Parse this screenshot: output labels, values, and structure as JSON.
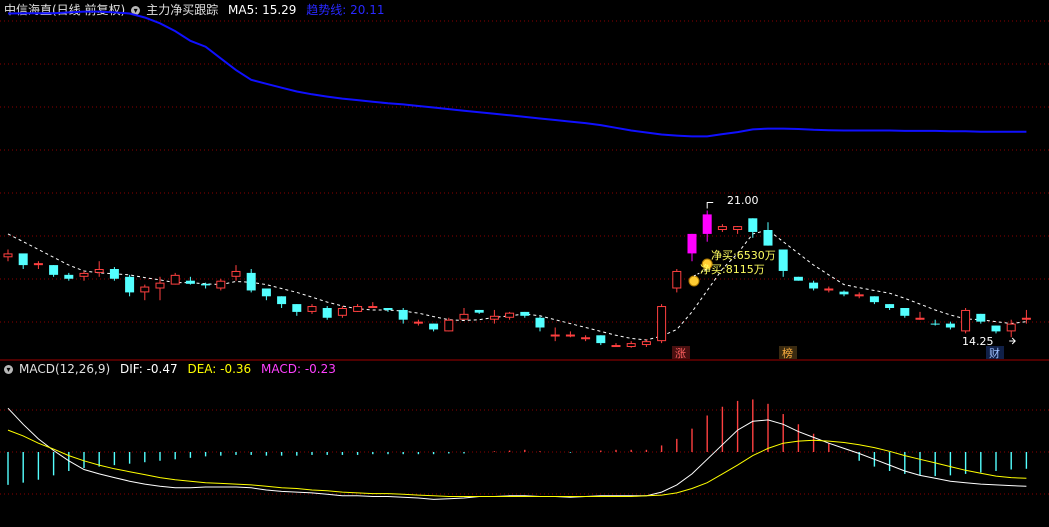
{
  "header": {
    "stock": "中信海直(日线 前复权)",
    "indicator": "主力净买跟踪",
    "ma5": "MA5: 15.29",
    "trend": "趋势线: 20.11"
  },
  "macd_header": {
    "name": "MACD(12,26,9)",
    "dif": "DIF: -0.47",
    "dea": "DEA: -0.36",
    "macd": "MACD: -0.23"
  },
  "annotations": {
    "high": "21.00",
    "low": "14.25",
    "netbuy1": "净买:6530万",
    "netbuy2": "净买:8115万",
    "tag_zhang": "涨",
    "tag_bang": "榜",
    "tag_cai": "财"
  },
  "colors": {
    "up": "#ff4040",
    "down": "#54ffff",
    "special": "#ff00ff",
    "trend_line": "#1010ff",
    "ma_dotted": "#ffffff",
    "dif": "#ffffff",
    "dea": "#ffff00",
    "grid": "#8b0000"
  },
  "chart_data": [
    {
      "type": "candlestick",
      "title": "中信海直(日线 前复权)",
      "candles": [
        [
          16.3,
          16.5,
          16.2,
          16.4
        ],
        [
          16.4,
          16.3,
          16.0,
          16.1
        ],
        [
          16.1,
          16.2,
          16.0,
          16.15
        ],
        [
          16.1,
          16.1,
          15.8,
          15.85
        ],
        [
          15.85,
          15.9,
          15.7,
          15.75
        ],
        [
          15.8,
          15.95,
          15.7,
          15.9
        ],
        [
          15.9,
          16.2,
          15.8,
          16.0
        ],
        [
          16.0,
          16.05,
          15.7,
          15.75
        ],
        [
          15.8,
          15.85,
          15.3,
          15.4
        ],
        [
          15.4,
          15.6,
          15.2,
          15.55
        ],
        [
          15.5,
          15.8,
          15.2,
          15.65
        ],
        [
          15.6,
          15.9,
          15.6,
          15.85
        ],
        [
          15.7,
          15.8,
          15.6,
          15.62
        ],
        [
          15.62,
          15.65,
          15.5,
          15.58
        ],
        [
          15.5,
          15.75,
          15.45,
          15.7
        ],
        [
          15.8,
          16.1,
          15.7,
          15.95
        ],
        [
          15.9,
          16.0,
          15.4,
          15.45
        ],
        [
          15.5,
          15.5,
          15.2,
          15.3
        ],
        [
          15.3,
          15.3,
          15.0,
          15.1
        ],
        [
          15.1,
          15.1,
          14.8,
          14.9
        ],
        [
          14.9,
          15.1,
          14.85,
          15.05
        ],
        [
          15.0,
          15.05,
          14.7,
          14.75
        ],
        [
          14.8,
          15.05,
          14.75,
          15.0
        ],
        [
          14.9,
          15.1,
          14.9,
          15.05
        ],
        [
          15.0,
          15.15,
          15.0,
          15.05
        ],
        [
          15.0,
          15.0,
          14.9,
          14.95
        ],
        [
          14.95,
          15.0,
          14.6,
          14.7
        ],
        [
          14.6,
          14.7,
          14.55,
          14.65
        ],
        [
          14.6,
          14.6,
          14.4,
          14.45
        ],
        [
          14.4,
          14.75,
          14.4,
          14.7
        ],
        [
          14.7,
          15.0,
          14.7,
          14.85
        ],
        [
          14.95,
          14.95,
          14.85,
          14.88
        ],
        [
          14.7,
          14.95,
          14.6,
          14.8
        ],
        [
          14.75,
          14.9,
          14.7,
          14.88
        ],
        [
          14.9,
          14.9,
          14.75,
          14.8
        ],
        [
          14.75,
          14.78,
          14.4,
          14.5
        ],
        [
          14.3,
          14.5,
          14.15,
          14.32
        ],
        [
          14.3,
          14.4,
          14.25,
          14.32
        ],
        [
          14.2,
          14.3,
          14.15,
          14.25
        ],
        [
          14.3,
          14.3,
          14.05,
          14.1
        ],
        [
          14.05,
          14.1,
          14.0,
          14.05
        ],
        [
          14.0,
          14.15,
          13.98,
          14.1
        ],
        [
          14.05,
          14.2,
          14.0,
          14.15
        ],
        [
          14.15,
          15.1,
          14.1,
          15.05
        ],
        [
          15.5,
          16.0,
          15.4,
          15.95
        ],
        [
          16.4,
          16.9,
          16.2,
          16.9
        ],
        [
          16.9,
          17.5,
          16.7,
          17.4
        ],
        [
          17.0,
          17.15,
          16.95,
          17.1
        ],
        [
          17.0,
          17.1,
          16.9,
          17.1
        ],
        [
          17.3,
          17.3,
          16.8,
          16.95
        ],
        [
          17.0,
          17.2,
          16.6,
          16.6
        ],
        [
          16.5,
          16.5,
          15.8,
          15.95
        ],
        [
          15.8,
          15.8,
          15.7,
          15.7
        ],
        [
          15.65,
          15.7,
          15.45,
          15.5
        ],
        [
          15.45,
          15.55,
          15.4,
          15.5
        ],
        [
          15.42,
          15.45,
          15.3,
          15.35
        ],
        [
          15.3,
          15.4,
          15.25,
          15.35
        ],
        [
          15.3,
          15.3,
          15.1,
          15.15
        ],
        [
          15.1,
          15.1,
          14.95,
          15.0
        ],
        [
          15.0,
          15.0,
          14.75,
          14.8
        ],
        [
          14.75,
          14.9,
          14.7,
          14.75
        ],
        [
          14.6,
          14.7,
          14.55,
          14.58
        ],
        [
          14.6,
          14.65,
          14.45,
          14.5
        ],
        [
          14.4,
          15.0,
          14.35,
          14.95
        ],
        [
          14.85,
          14.85,
          14.6,
          14.65
        ],
        [
          14.55,
          14.55,
          14.35,
          14.4
        ],
        [
          14.4,
          14.7,
          14.25,
          14.6
        ],
        [
          14.7,
          14.95,
          14.6,
          14.75
        ]
      ],
      "ma5": [
        16.9,
        16.7,
        16.5,
        16.3,
        16.1,
        15.95,
        15.9,
        15.88,
        15.85,
        15.78,
        15.72,
        15.65,
        15.65,
        15.62,
        15.6,
        15.68,
        15.66,
        15.6,
        15.5,
        15.4,
        15.28,
        15.15,
        15.05,
        14.98,
        14.95,
        14.95,
        14.92,
        14.87,
        14.78,
        14.7,
        14.68,
        14.7,
        14.76,
        14.8,
        14.85,
        14.8,
        14.7,
        14.6,
        14.5,
        14.4,
        14.3,
        14.22,
        14.18,
        14.28,
        14.45,
        14.9,
        15.45,
        16.0,
        16.4,
        16.9,
        17.0,
        16.7,
        16.4,
        16.1,
        15.85,
        15.6,
        15.52,
        15.45,
        15.38,
        15.25,
        15.1,
        14.95,
        14.82,
        14.72,
        14.7,
        14.65,
        14.6,
        14.65
      ],
      "trend_line": [
        22.55,
        22.56,
        22.56,
        22.56,
        22.58,
        22.6,
        22.6,
        22.58,
        22.55,
        22.45,
        22.3,
        22.1,
        21.85,
        21.7,
        21.4,
        21.1,
        20.85,
        20.75,
        20.65,
        20.55,
        20.48,
        20.42,
        20.37,
        20.33,
        20.29,
        20.25,
        20.22,
        20.18,
        20.14,
        20.1,
        20.06,
        20.02,
        19.98,
        19.94,
        19.9,
        19.86,
        19.82,
        19.78,
        19.74,
        19.69,
        19.62,
        19.55,
        19.5,
        19.45,
        19.42,
        19.4,
        19.4,
        19.46,
        19.51,
        19.58,
        19.6,
        19.6,
        19.59,
        19.57,
        19.56,
        19.55,
        19.55,
        19.55,
        19.55,
        19.54,
        19.54,
        19.54,
        19.53,
        19.53,
        19.52,
        19.52,
        19.52,
        19.52
      ],
      "annotations": [
        "21.00",
        "14.25",
        "净买:6530万",
        "净买:8115万"
      ]
    },
    {
      "type": "macd",
      "title": "MACD(12,26,9)",
      "dif_last": -0.47,
      "dea_last": -0.36,
      "macd_last": -0.23,
      "dif": [
        0.6,
        0.38,
        0.18,
        0.02,
        -0.12,
        -0.24,
        -0.3,
        -0.35,
        -0.4,
        -0.44,
        -0.47,
        -0.49,
        -0.49,
        -0.48,
        -0.48,
        -0.48,
        -0.49,
        -0.52,
        -0.54,
        -0.55,
        -0.56,
        -0.58,
        -0.6,
        -0.6,
        -0.61,
        -0.61,
        -0.62,
        -0.63,
        -0.65,
        -0.64,
        -0.63,
        -0.61,
        -0.61,
        -0.6,
        -0.6,
        -0.61,
        -0.61,
        -0.62,
        -0.61,
        -0.6,
        -0.6,
        -0.6,
        -0.6,
        -0.55,
        -0.45,
        -0.3,
        -0.1,
        0.1,
        0.3,
        0.42,
        0.44,
        0.38,
        0.28,
        0.2,
        0.12,
        0.05,
        -0.02,
        -0.1,
        -0.18,
        -0.26,
        -0.32,
        -0.36,
        -0.4,
        -0.42,
        -0.44,
        -0.45,
        -0.46,
        -0.47
      ],
      "dea": [
        0.3,
        0.22,
        0.12,
        0.04,
        -0.05,
        -0.12,
        -0.18,
        -0.23,
        -0.27,
        -0.31,
        -0.35,
        -0.38,
        -0.4,
        -0.42,
        -0.43,
        -0.44,
        -0.45,
        -0.47,
        -0.49,
        -0.5,
        -0.52,
        -0.53,
        -0.55,
        -0.56,
        -0.57,
        -0.57,
        -0.58,
        -0.59,
        -0.6,
        -0.61,
        -0.61,
        -0.61,
        -0.61,
        -0.61,
        -0.61,
        -0.61,
        -0.61,
        -0.61,
        -0.61,
        -0.61,
        -0.61,
        -0.61,
        -0.6,
        -0.59,
        -0.56,
        -0.5,
        -0.42,
        -0.3,
        -0.18,
        -0.05,
        0.05,
        0.12,
        0.15,
        0.16,
        0.15,
        0.13,
        0.1,
        0.06,
        0.01,
        -0.05,
        -0.1,
        -0.15,
        -0.2,
        -0.25,
        -0.29,
        -0.33,
        -0.35,
        -0.36
      ],
      "macd_hist": [
        -0.45,
        -0.42,
        -0.38,
        -0.32,
        -0.26,
        -0.22,
        -0.2,
        -0.18,
        -0.16,
        -0.14,
        -0.12,
        -0.1,
        -0.08,
        -0.06,
        -0.05,
        -0.04,
        -0.04,
        -0.05,
        -0.05,
        -0.05,
        -0.04,
        -0.04,
        -0.04,
        -0.04,
        -0.03,
        -0.03,
        -0.03,
        -0.03,
        -0.03,
        -0.02,
        -0.02,
        0,
        0.01,
        0.02,
        0.03,
        0.01,
        0,
        -0.01,
        0,
        0.02,
        0.03,
        0.03,
        0.03,
        0.09,
        0.18,
        0.32,
        0.5,
        0.62,
        0.7,
        0.72,
        0.66,
        0.52,
        0.38,
        0.25,
        0.12,
        0,
        -0.12,
        -0.2,
        -0.26,
        -0.3,
        -0.32,
        -0.33,
        -0.32,
        -0.3,
        -0.28,
        -0.26,
        -0.24,
        -0.23
      ]
    }
  ]
}
